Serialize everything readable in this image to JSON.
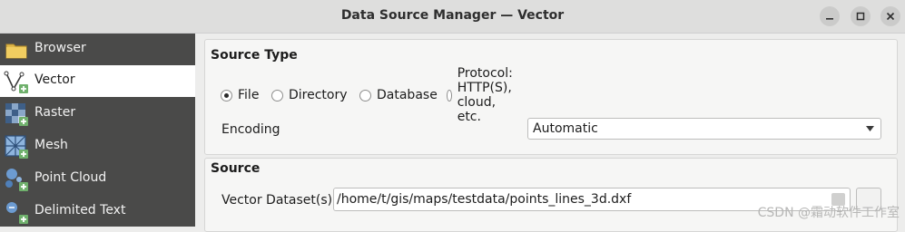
{
  "window": {
    "title": "Data Source Manager — Vector",
    "controls": {
      "minimize_icon": "minimize-icon",
      "maximize_icon": "maximize-icon",
      "close_icon": "close-icon"
    }
  },
  "sidebar": {
    "items": [
      {
        "label": "Browser",
        "icon": "folder-icon",
        "active": false
      },
      {
        "label": "Vector",
        "icon": "vector-add-icon",
        "active": true
      },
      {
        "label": "Raster",
        "icon": "raster-add-icon",
        "active": false
      },
      {
        "label": "Mesh",
        "icon": "mesh-add-icon",
        "active": false
      },
      {
        "label": "Point Cloud",
        "icon": "point-cloud-add-icon",
        "active": false
      },
      {
        "label": "Delimited Text",
        "icon": "delimited-text-add-icon",
        "active": false
      }
    ]
  },
  "source_type": {
    "heading": "Source Type",
    "options": [
      {
        "label": "File",
        "selected": true
      },
      {
        "label": "Directory",
        "selected": false
      },
      {
        "label": "Database",
        "selected": false
      },
      {
        "label": "Protocol: HTTP(S), cloud, etc.",
        "selected": false
      }
    ],
    "encoding_label": "Encoding",
    "encoding_value": "Automatic"
  },
  "source": {
    "heading": "Source",
    "dataset_label": "Vector Dataset(s)",
    "dataset_value": "/home/t/gis/maps/testdata/points_lines_3d.dxf"
  },
  "watermark": "CSDN @霜动软件工作室",
  "colors": {
    "sidebar_bg": "#4a4a49",
    "panel_bg": "#f6f6f5",
    "window_bg": "#ededec"
  }
}
